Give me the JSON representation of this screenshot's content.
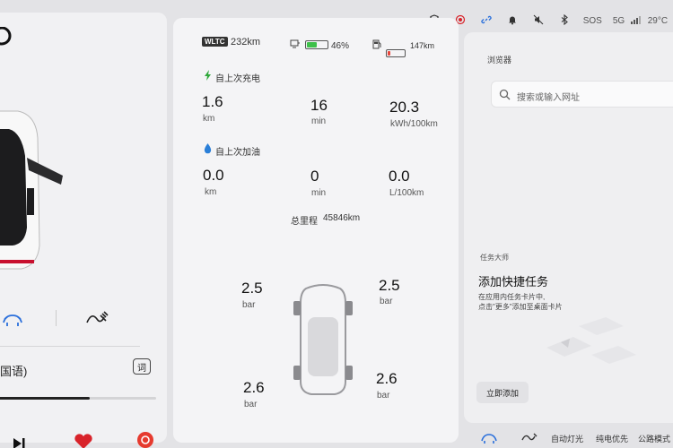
{
  "status_bar": {
    "sos": "SOS",
    "network": "5G",
    "temp": "29°C"
  },
  "vehicle": {
    "wltc_badge": "WLTC",
    "wltc_range": "232km",
    "battery_percent": "46%",
    "battery_level": 0.46,
    "fuel_range": "147km",
    "fuel_level": 0.15
  },
  "since_charge": {
    "title": "自上次充电",
    "stats": [
      {
        "value": "1.6",
        "unit": "km"
      },
      {
        "value": "16",
        "unit": "min"
      },
      {
        "value": "20.3",
        "unit": "kWh/100km"
      }
    ]
  },
  "since_refuel": {
    "title": "自上次加油",
    "stats": [
      {
        "value": "0.0",
        "unit": "km"
      },
      {
        "value": "0",
        "unit": "min"
      },
      {
        "value": "0.0",
        "unit": "L/100km"
      }
    ]
  },
  "odometer": {
    "label": "总里程",
    "value": "45846km"
  },
  "tires": {
    "front_left": {
      "value": "2.5",
      "unit": "bar"
    },
    "front_right": {
      "value": "2.5",
      "unit": "bar"
    },
    "rear_left": {
      "value": "2.6",
      "unit": "bar"
    },
    "rear_right": {
      "value": "2.6",
      "unit": "bar"
    }
  },
  "browser": {
    "title": "浏览器",
    "search_placeholder": "搜索或输入网址"
  },
  "task_master": {
    "title": "任务大师",
    "heading": "添加快捷任务",
    "desc_line1": "在应用内任务卡片中,",
    "desc_line2": "点击\"更多\"添加至桌面卡片",
    "add_button": "立即添加"
  },
  "media": {
    "song_suffix": "国语)",
    "lyrics_icon": "词",
    "progress": 0.62
  },
  "dock": {
    "auto_lights": "自动灯光",
    "ev_priority": "纯电优先",
    "road_mode": "公路模式"
  },
  "colors": {
    "accent_blue": "#2a6fdb",
    "battery_green": "#3ec04a",
    "heart_red": "#d8232a",
    "charge_green": "#2fa83a",
    "fuel_blue": "#2a7fd8"
  }
}
